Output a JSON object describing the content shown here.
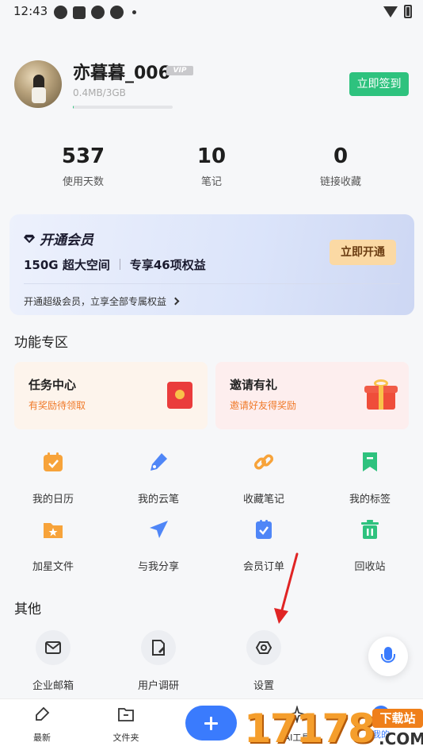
{
  "status_bar": {
    "time": "12:43"
  },
  "profile": {
    "username": "亦暮暮_006",
    "vip_badge": "VIP",
    "storage_text": "0.4MB/3GB",
    "storage_used_fraction": 0.002,
    "signin_label": "立即签到"
  },
  "stats": [
    {
      "value": "537",
      "label": "使用天数"
    },
    {
      "value": "10",
      "label": "笔记"
    },
    {
      "value": "0",
      "label": "链接收藏"
    }
  ],
  "vip_card": {
    "title": "开通会员",
    "feature1": "150G 超大空间",
    "feature2": "专享46项权益",
    "button": "立即开通",
    "subtitle": "开通超级会员，立享全部专属权益"
  },
  "features_section": {
    "title": "功能专区",
    "promos": [
      {
        "title": "任务中心",
        "subtitle": "有奖励待领取"
      },
      {
        "title": "邀请有礼",
        "subtitle": "邀请好友得奖励"
      }
    ],
    "grid": [
      {
        "label": "我的日历",
        "icon": "calendar-icon"
      },
      {
        "label": "我的云笔",
        "icon": "pen-icon"
      },
      {
        "label": "收藏笔记",
        "icon": "link-icon"
      },
      {
        "label": "我的标签",
        "icon": "bookmark-icon"
      },
      {
        "label": "加星文件",
        "icon": "star-folder-icon"
      },
      {
        "label": "与我分享",
        "icon": "send-icon"
      },
      {
        "label": "会员订单",
        "icon": "order-icon"
      },
      {
        "label": "回收站",
        "icon": "trash-icon"
      }
    ]
  },
  "other_section": {
    "title": "其他",
    "items": [
      {
        "label": "企业邮箱",
        "icon": "mail-icon"
      },
      {
        "label": "用户调研",
        "icon": "survey-icon"
      },
      {
        "label": "设置",
        "icon": "settings-icon"
      }
    ]
  },
  "bottom_nav": [
    {
      "label": "最新",
      "icon": "latest-icon"
    },
    {
      "label": "文件夹",
      "icon": "folder-icon"
    },
    {
      "label": "AI工具",
      "icon": "ai-icon"
    },
    {
      "label": "我的",
      "icon": "me-icon"
    }
  ],
  "watermark": {
    "number": "17178",
    "tag": "下载站",
    "domain": ".COM"
  },
  "colors": {
    "accent_green": "#2ec27e",
    "accent_blue": "#3a7bfd",
    "icon_orange": "#f7a33a",
    "promo_orange": "#f07a2a",
    "annotation_red": "#e02424"
  }
}
